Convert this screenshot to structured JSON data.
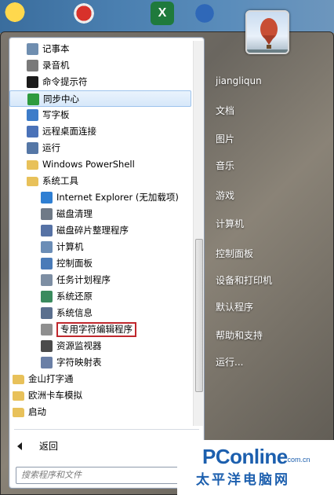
{
  "desktop_icons": [
    "smiley-icon",
    "ie-icon",
    "excel-icon",
    "basketball-icon"
  ],
  "program_list": [
    {
      "label": "记事本",
      "icon": "notepad-icon",
      "indent": 1,
      "color": "#6f8eb0"
    },
    {
      "label": "录音机",
      "icon": "microphone-icon",
      "indent": 1,
      "color": "#7a7a7a"
    },
    {
      "label": "命令提示符",
      "icon": "cmd-icon",
      "indent": 1,
      "color": "#1a1a1a"
    },
    {
      "label": "同步中心",
      "icon": "sync-icon",
      "indent": 1,
      "color": "#2e9b3e",
      "highlighted": true
    },
    {
      "label": "写字板",
      "icon": "wordpad-icon",
      "indent": 1,
      "color": "#3d7cc9"
    },
    {
      "label": "远程桌面连接",
      "icon": "remote-desktop-icon",
      "indent": 1,
      "color": "#4a72b8"
    },
    {
      "label": "运行",
      "icon": "run-icon",
      "indent": 1,
      "color": "#5577a6"
    },
    {
      "label": "Windows PowerShell",
      "icon": "folder-icon",
      "indent": 1,
      "color": "#e8c15a"
    },
    {
      "label": "系统工具",
      "icon": "folder-icon",
      "indent": 1,
      "color": "#e8c15a"
    },
    {
      "label": "Internet Explorer (无加载项)",
      "icon": "ie-icon",
      "indent": 2,
      "color": "#2f7fd3"
    },
    {
      "label": "磁盘清理",
      "icon": "disk-cleanup-icon",
      "indent": 2,
      "color": "#6f7a87"
    },
    {
      "label": "磁盘碎片整理程序",
      "icon": "defrag-icon",
      "indent": 2,
      "color": "#5672a5"
    },
    {
      "label": "计算机",
      "icon": "computer-icon",
      "indent": 2,
      "color": "#6b8db6"
    },
    {
      "label": "控制面板",
      "icon": "control-panel-icon",
      "indent": 2,
      "color": "#4a7bb8"
    },
    {
      "label": "任务计划程序",
      "icon": "task-scheduler-icon",
      "indent": 2,
      "color": "#7d8ea3"
    },
    {
      "label": "系统还原",
      "icon": "system-restore-icon",
      "indent": 2,
      "color": "#3a8b5e"
    },
    {
      "label": "系统信息",
      "icon": "system-info-icon",
      "indent": 2,
      "color": "#5a6f8e"
    },
    {
      "label": "专用字符编辑程序",
      "icon": "char-editor-icon",
      "indent": 2,
      "color": "#8f8f8f",
      "boxed": true
    },
    {
      "label": "资源监视器",
      "icon": "resource-monitor-icon",
      "indent": 2,
      "color": "#4b4b4b"
    },
    {
      "label": "字符映射表",
      "icon": "char-map-icon",
      "indent": 2,
      "color": "#6a7fa6"
    },
    {
      "label": "金山打字通",
      "icon": "folder-icon",
      "indent": 0,
      "color": "#e8c15a"
    },
    {
      "label": "欧洲卡车模拟",
      "icon": "folder-icon",
      "indent": 0,
      "color": "#e8c15a"
    },
    {
      "label": "启动",
      "icon": "folder-icon",
      "indent": 0,
      "color": "#e8c15a"
    }
  ],
  "back_label": "返回",
  "search_placeholder": "搜索程序和文件",
  "right_pane": [
    "jiangliqun",
    "文档",
    "图片",
    "音乐",
    "游戏",
    "计算机",
    "控制面板",
    "设备和打印机",
    "默认程序",
    "帮助和支持",
    "运行..."
  ],
  "watermark": {
    "line1": "PConline",
    "line1_suffix": ".com.cn",
    "line2": "太平洋电脑网"
  },
  "colors": {
    "highlight_border": "#9ec3ec",
    "box_red": "#c0282d",
    "brand_blue": "#1c5fae"
  }
}
